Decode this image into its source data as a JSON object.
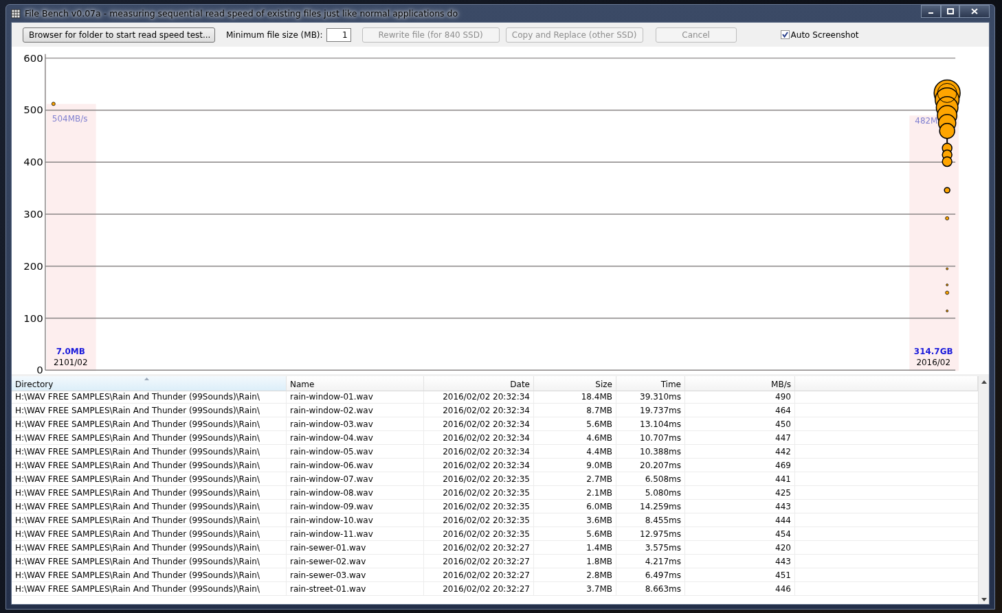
{
  "window": {
    "title": "File Bench v0.07a - measuring sequential read speed of existing files just like normal applications do"
  },
  "toolbar": {
    "browse_button": {
      "label": "Browser for folder to start read speed test..."
    },
    "min_size": {
      "label": "Minimum file size (MB):",
      "value": "1"
    },
    "buttons": [
      {
        "label": "Rewrite file (for 840 SSD)",
        "disabled": true
      },
      {
        "label": "Copy and Replace (other SSD)",
        "disabled": true
      },
      {
        "label": "Cancel",
        "disabled": true
      }
    ],
    "auto_screenshot": {
      "label": "Auto Screenshot",
      "checked": true
    }
  },
  "chart": {
    "y_axis": [
      "600",
      "500",
      "400",
      "300",
      "200",
      "100",
      "0"
    ],
    "columns": [
      {
        "speed": "504MB/s",
        "size": "7.0MB",
        "month": "2101/02"
      },
      {
        "speed": "482M",
        "size": "314.7GB",
        "month": "2016/02"
      }
    ]
  },
  "table": {
    "columns": [
      {
        "label": "Directory",
        "sorted": true
      },
      {
        "label": "Name",
        "sorted": false
      },
      {
        "label": "Date",
        "sorted": false
      },
      {
        "label": "Size",
        "sorted": false
      },
      {
        "label": "Time",
        "sorted": false
      },
      {
        "label": "MB/s",
        "sorted": false
      }
    ],
    "rows": [
      [
        "H:\\WAV FREE SAMPLES\\Rain And Thunder (99Sounds)\\Rain\\",
        "rain-window-01.wav",
        "2016/02/02 20:32:34",
        "18.4MB",
        "39.310ms",
        "490"
      ],
      [
        "H:\\WAV FREE SAMPLES\\Rain And Thunder (99Sounds)\\Rain\\",
        "rain-window-02.wav",
        "2016/02/02 20:32:34",
        "8.7MB",
        "19.737ms",
        "464"
      ],
      [
        "H:\\WAV FREE SAMPLES\\Rain And Thunder (99Sounds)\\Rain\\",
        "rain-window-03.wav",
        "2016/02/02 20:32:34",
        "5.6MB",
        "13.104ms",
        "450"
      ],
      [
        "H:\\WAV FREE SAMPLES\\Rain And Thunder (99Sounds)\\Rain\\",
        "rain-window-04.wav",
        "2016/02/02 20:32:34",
        "4.6MB",
        "10.707ms",
        "447"
      ],
      [
        "H:\\WAV FREE SAMPLES\\Rain And Thunder (99Sounds)\\Rain\\",
        "rain-window-05.wav",
        "2016/02/02 20:32:34",
        "4.4MB",
        "10.388ms",
        "442"
      ],
      [
        "H:\\WAV FREE SAMPLES\\Rain And Thunder (99Sounds)\\Rain\\",
        "rain-window-06.wav",
        "2016/02/02 20:32:34",
        "9.0MB",
        "20.207ms",
        "469"
      ],
      [
        "H:\\WAV FREE SAMPLES\\Rain And Thunder (99Sounds)\\Rain\\",
        "rain-window-07.wav",
        "2016/02/02 20:32:35",
        "2.7MB",
        "6.508ms",
        "441"
      ],
      [
        "H:\\WAV FREE SAMPLES\\Rain And Thunder (99Sounds)\\Rain\\",
        "rain-window-08.wav",
        "2016/02/02 20:32:35",
        "2.1MB",
        "5.080ms",
        "425"
      ],
      [
        "H:\\WAV FREE SAMPLES\\Rain And Thunder (99Sounds)\\Rain\\",
        "rain-window-09.wav",
        "2016/02/02 20:32:35",
        "6.0MB",
        "14.259ms",
        "443"
      ],
      [
        "H:\\WAV FREE SAMPLES\\Rain And Thunder (99Sounds)\\Rain\\",
        "rain-window-10.wav",
        "2016/02/02 20:32:35",
        "3.6MB",
        "8.455ms",
        "444"
      ],
      [
        "H:\\WAV FREE SAMPLES\\Rain And Thunder (99Sounds)\\Rain\\",
        "rain-window-11.wav",
        "2016/02/02 20:32:35",
        "5.6MB",
        "12.975ms",
        "454"
      ],
      [
        "H:\\WAV FREE SAMPLES\\Rain And Thunder (99Sounds)\\Rain\\",
        "rain-sewer-01.wav",
        "2016/02/02 20:32:27",
        "1.4MB",
        "3.575ms",
        "420"
      ],
      [
        "H:\\WAV FREE SAMPLES\\Rain And Thunder (99Sounds)\\Rain\\",
        "rain-sewer-02.wav",
        "2016/02/02 20:32:27",
        "1.8MB",
        "4.217ms",
        "443"
      ],
      [
        "H:\\WAV FREE SAMPLES\\Rain And Thunder (99Sounds)\\Rain\\",
        "rain-sewer-03.wav",
        "2016/02/02 20:32:27",
        "2.8MB",
        "6.497ms",
        "451"
      ],
      [
        "H:\\WAV FREE SAMPLES\\Rain And Thunder (99Sounds)\\Rain\\",
        "rain-street-01.wav",
        "2016/02/02 20:32:27",
        "3.7MB",
        "8.663ms",
        "446"
      ]
    ]
  }
}
